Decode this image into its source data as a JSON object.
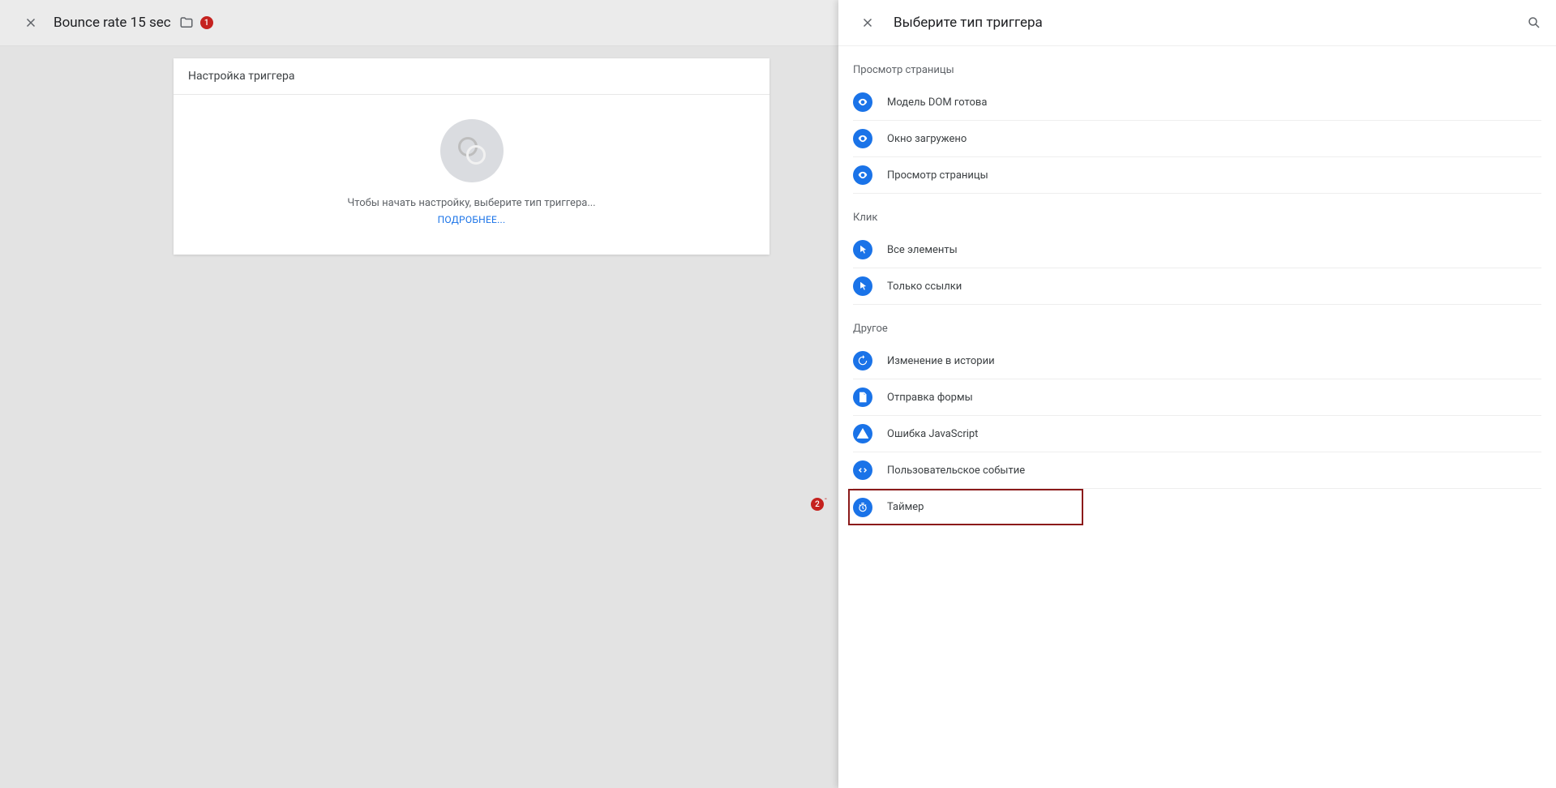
{
  "left": {
    "title": "Bounce rate 15 sec",
    "badge": "1",
    "card_title": "Настройка триггера",
    "placeholder_text": "Чтобы начать настройку, выберите тип триггера...",
    "learn_more": "ПОДРОБНЕЕ..."
  },
  "annotation2": "2",
  "panel": {
    "title": "Выберите тип триггера",
    "sections": [
      {
        "label": "Просмотр страницы",
        "items": [
          {
            "icon": "eye",
            "label": "Модель DOM готова"
          },
          {
            "icon": "eye",
            "label": "Окно загружено"
          },
          {
            "icon": "eye",
            "label": "Просмотр страницы"
          }
        ]
      },
      {
        "label": "Клик",
        "items": [
          {
            "icon": "cursor",
            "label": "Все элементы"
          },
          {
            "icon": "cursor",
            "label": "Только ссылки"
          }
        ]
      },
      {
        "label": "Другое",
        "items": [
          {
            "icon": "history",
            "label": "Изменение в истории"
          },
          {
            "icon": "form",
            "label": "Отправка формы"
          },
          {
            "icon": "warning",
            "label": "Ошибка JavaScript"
          },
          {
            "icon": "code",
            "label": "Пользовательское событие"
          },
          {
            "icon": "timer",
            "label": "Таймер",
            "highlighted": true
          }
        ]
      }
    ]
  }
}
